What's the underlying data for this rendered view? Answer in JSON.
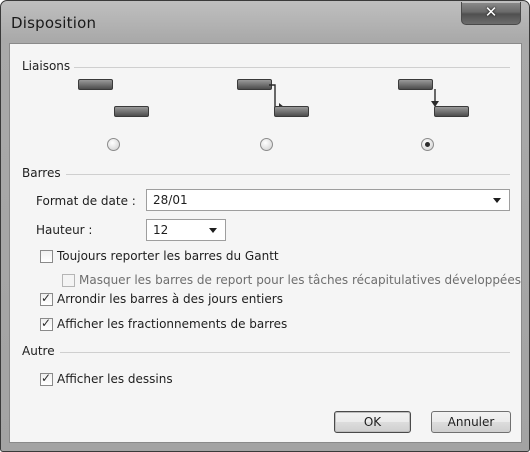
{
  "dialog": {
    "title": "Disposition",
    "close_glyph": "✕"
  },
  "liaisons": {
    "label": "Liaisons",
    "selected_index": 2,
    "options": [
      {
        "style": "no-connector"
      },
      {
        "style": "connector-from-end"
      },
      {
        "style": "connector-from-start"
      }
    ]
  },
  "barres": {
    "label": "Barres",
    "date_format_label": "Format de date :",
    "date_format_value": "28/01",
    "height_label": "Hauteur :",
    "height_value": "12",
    "checks": [
      {
        "label": "Toujours reporter les barres du Gantt",
        "checked": false,
        "enabled": true
      },
      {
        "label": "Masquer les barres de report pour les tâches récapitulatives développées",
        "checked": false,
        "enabled": false
      },
      {
        "label": "Arrondir les barres à des jours entiers",
        "checked": true,
        "enabled": true
      },
      {
        "label": "Afficher les fractionnements de barres",
        "checked": true,
        "enabled": true
      }
    ]
  },
  "autre": {
    "label": "Autre",
    "checks": [
      {
        "label": "Afficher les dessins",
        "checked": true,
        "enabled": true
      }
    ]
  },
  "buttons": {
    "ok": "OK",
    "cancel": "Annuler"
  },
  "icons": {
    "close": "close-icon",
    "dropdown": "chevron-down-icon",
    "check": "check-icon"
  },
  "colors": {
    "frame": "#a9a9a9",
    "client": "#f5f5f5",
    "gantt_bar": "#5a5a5a"
  }
}
